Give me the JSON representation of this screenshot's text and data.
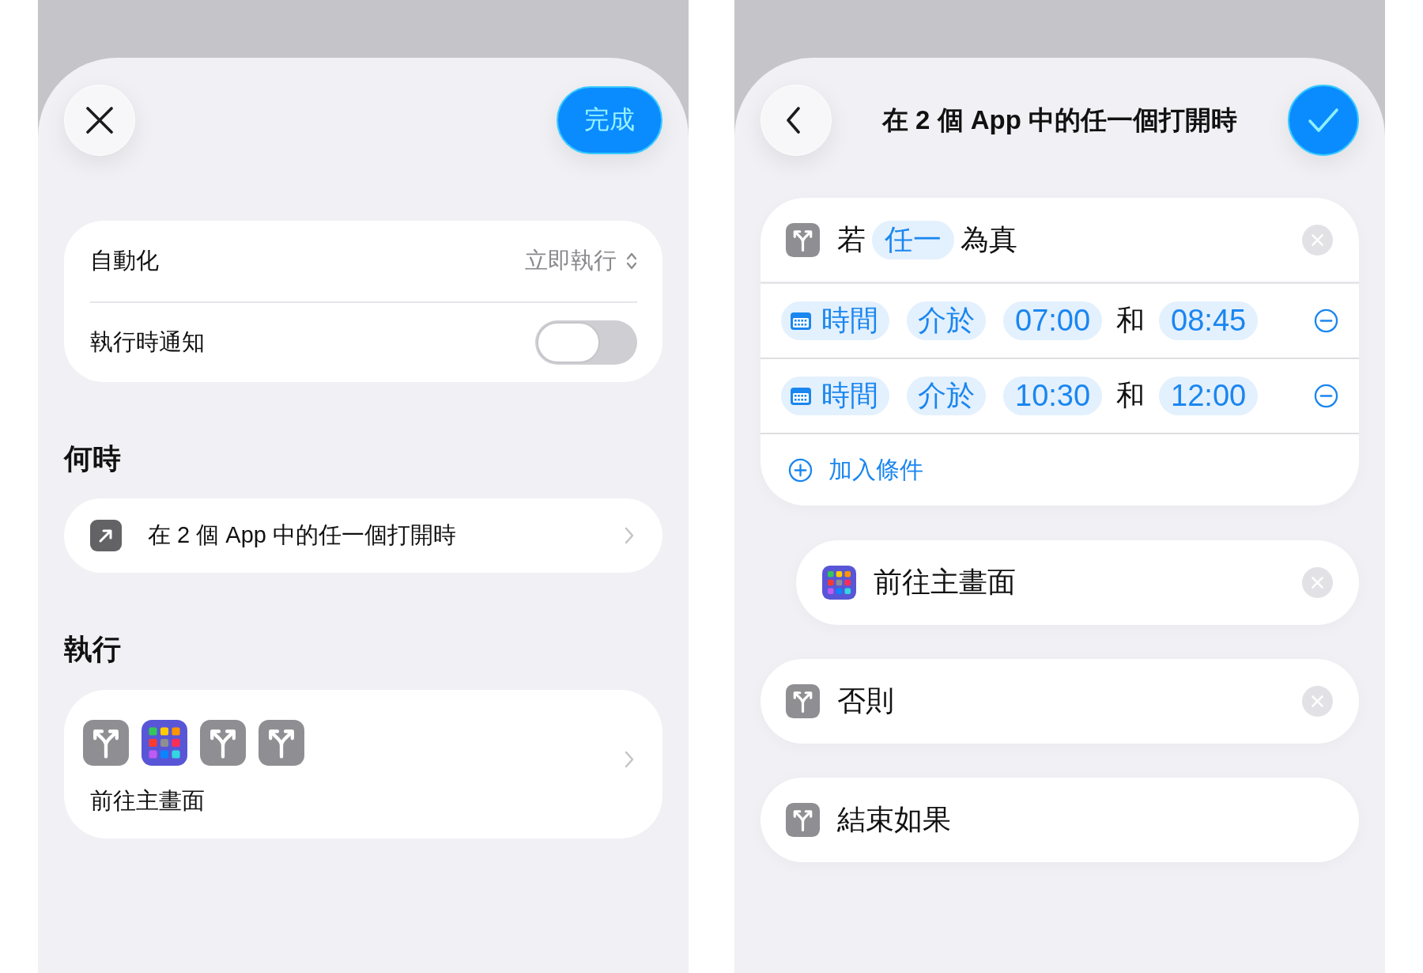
{
  "automation_sheet": {
    "done_button": {
      "label": "完成"
    },
    "settings": [
      {
        "kind": "picker",
        "label": "自動化",
        "value": "立即執行"
      },
      {
        "kind": "toggle",
        "label": "執行時通知",
        "on": false
      }
    ],
    "sections": [
      {
        "kind": "trigger",
        "heading": "何時",
        "text": "在 2 個 App 中的任一個打開時"
      },
      {
        "kind": "actions",
        "heading": "執行",
        "action_icons": [
          {
            "kind": "if"
          },
          {
            "kind": "home"
          },
          {
            "kind": "else"
          },
          {
            "kind": "end"
          }
        ],
        "text": "前往主畫面"
      }
    ]
  },
  "trigger_sheet": {
    "title": "在 2 個 App 中的任一個打開時",
    "blocks": [
      {
        "kind": "if",
        "prefix": "若",
        "mode": "任一",
        "suffix": "為真",
        "removable": true,
        "conditions": [
          {
            "subject": "時間",
            "operator": "介於",
            "start": "07:00",
            "joiner": "和",
            "end": "08:45"
          },
          {
            "subject": "時間",
            "operator": "介於",
            "start": "10:30",
            "joiner": "和",
            "end": "12:00"
          }
        ],
        "add_label": "加入條件",
        "children": [
          {
            "kind": "home",
            "label": "前往主畫面",
            "removable": true
          }
        ]
      },
      {
        "kind": "else",
        "label": "否則",
        "removable": true
      },
      {
        "kind": "end",
        "label": "結束如果",
        "removable": false
      }
    ]
  }
}
